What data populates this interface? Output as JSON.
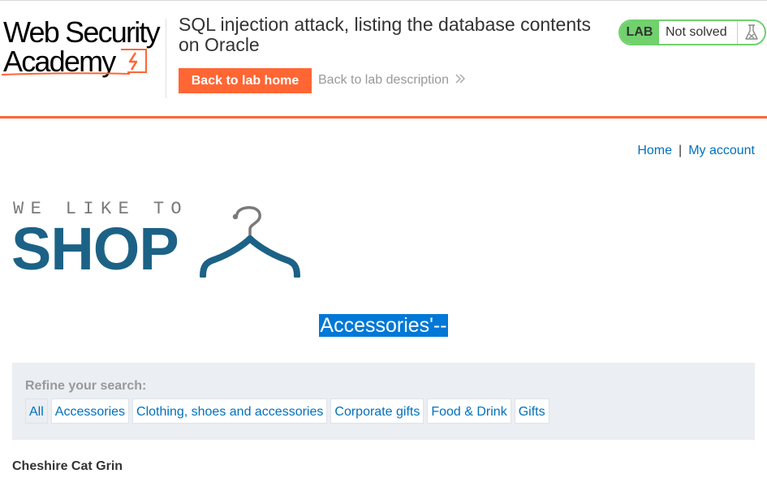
{
  "academy": {
    "logo_line1": "Web Security",
    "logo_line2": "Academy",
    "lab_title": "SQL injection attack, listing the database contents on Oracle",
    "back_home_label": "Back to lab home",
    "back_description_label": "Back to lab description",
    "lab_badge": "LAB",
    "lab_status": "Not solved",
    "colors": {
      "accent": "#ff6633",
      "status_green": "#70d16d"
    }
  },
  "nav": {
    "home_label": "Home",
    "separator": "|",
    "my_account_label": "My account"
  },
  "shop_logo": {
    "tagline": "WE LIKE TO",
    "word": "SHOP"
  },
  "search": {
    "term": "Accessories'--"
  },
  "refine": {
    "label": "Refine your search:",
    "categories": [
      "All",
      "Accessories",
      "Clothing, shoes and accessories",
      "Corporate gifts",
      "Food & Drink",
      "Gifts"
    ]
  },
  "products": [
    {
      "name": "Cheshire Cat Grin"
    }
  ],
  "icons": [
    "flask-icon",
    "lightning-icon",
    "hanger-icon",
    "double-chevron-right-icon"
  ]
}
